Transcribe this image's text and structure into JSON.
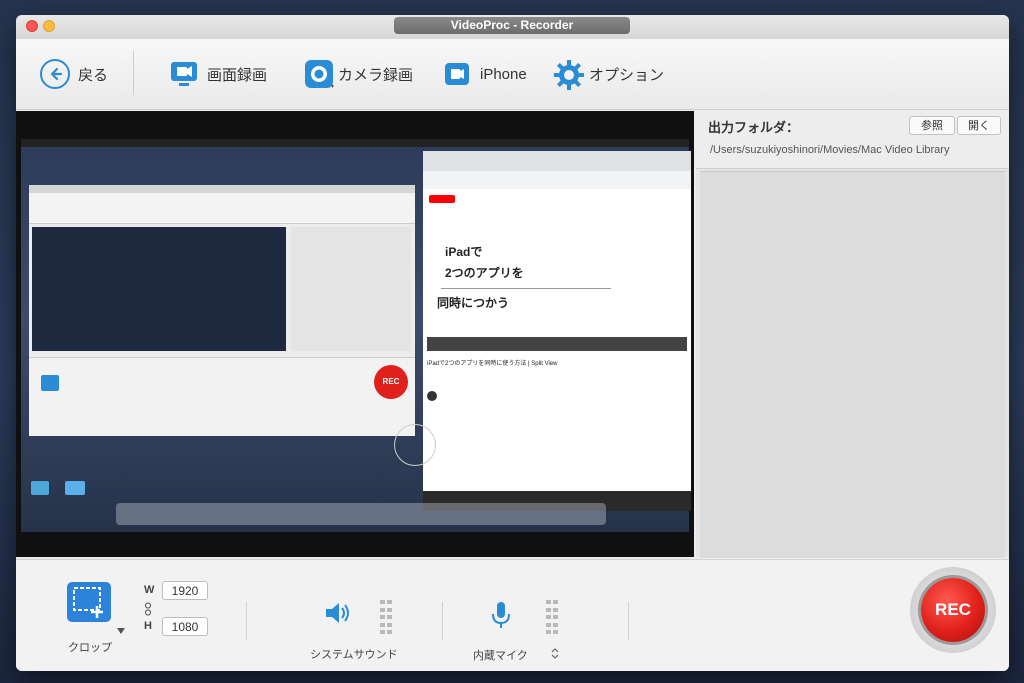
{
  "window": {
    "title": "VideoProc - Recorder"
  },
  "toolbar": {
    "back_label": "戻る",
    "screen_label": "画面録画",
    "camera_label": "カメラ録画",
    "iphone_label": "iPhone",
    "options_label": "オプション"
  },
  "output": {
    "label": "出力フォルダ：",
    "browse_label": "参照",
    "open_label": "開く",
    "path": "/Users/suzukiyoshinori/Movies/Mac Video Library"
  },
  "preview": {
    "yt_line1": "iPadで",
    "yt_line2": "2つのアプリを",
    "yt_line3": "同時につかう",
    "yt_title": "iPadで2つのアプリを同時に使う方法 | Split View",
    "rec_label": "REC"
  },
  "controls": {
    "crop_label": "クロップ",
    "w_label": "W",
    "h_label": "H",
    "width": "1920",
    "height": "1080",
    "system_sound_label": "システムサウンド",
    "mic_label": "内蔵マイク",
    "rec_label": "REC"
  },
  "colors": {
    "accent": "#2b8cd6",
    "rec": "#e0201b"
  }
}
